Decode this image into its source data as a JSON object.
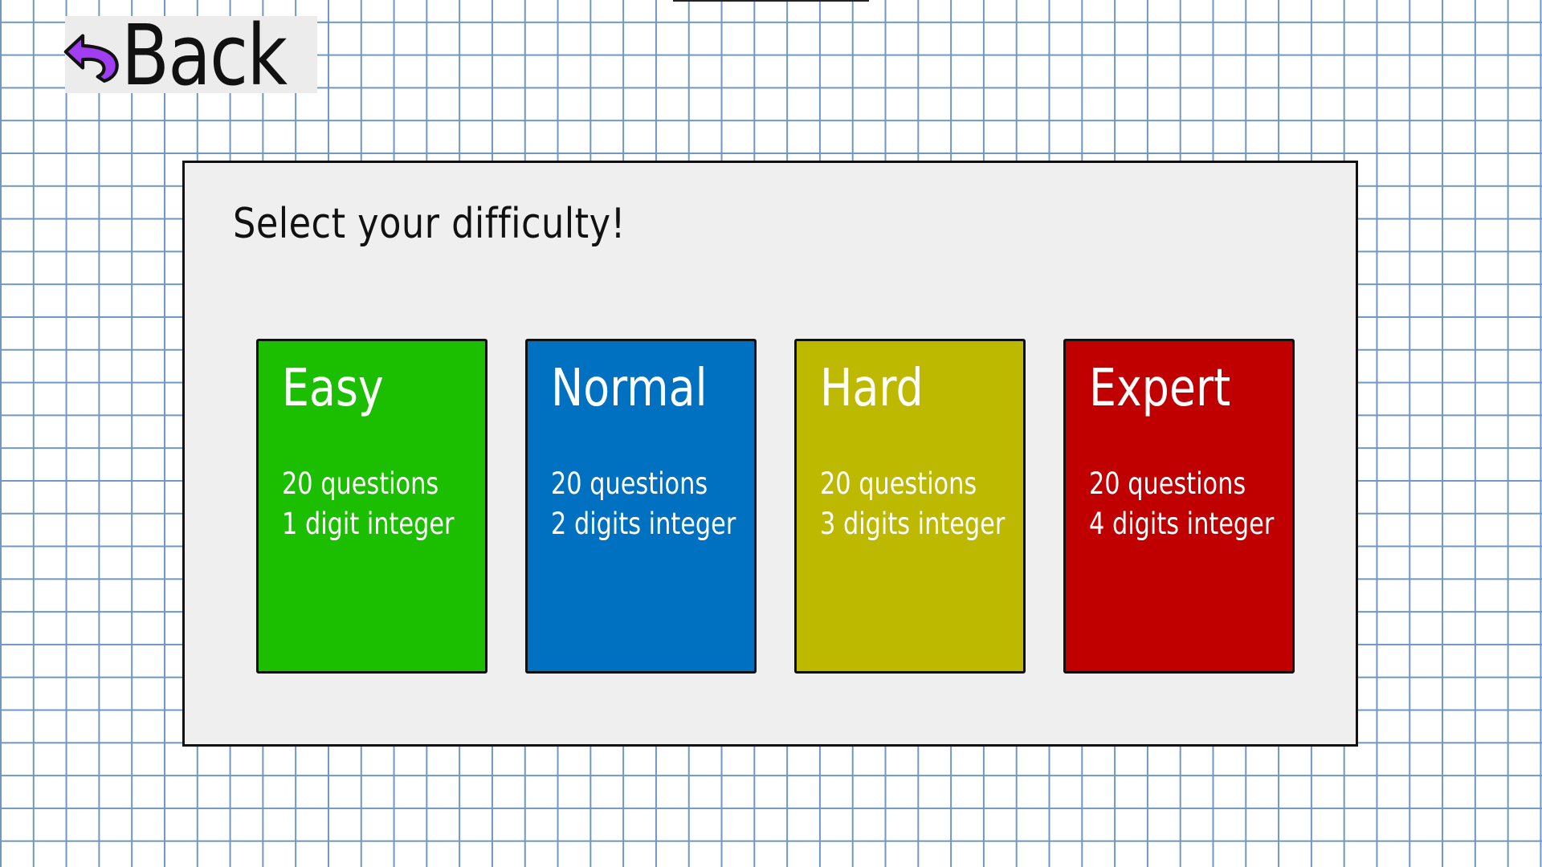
{
  "back": {
    "label": "Back",
    "icon": "curved-back-arrow-icon",
    "icon_color": "#a23ef2"
  },
  "panel": {
    "title": "Select your difficulty!"
  },
  "cards": [
    {
      "title": "Easy",
      "line1": "20 questions",
      "line2": "1 digit integer",
      "color": "#1bbf00"
    },
    {
      "title": "Normal",
      "line1": "20 questions",
      "line2": "2 digits integer",
      "color": "#0070c0"
    },
    {
      "title": "Hard",
      "line1": "20 questions",
      "line2": "3 digits integer",
      "color": "#bcb900"
    },
    {
      "title": "Expert",
      "line1": "20 questions",
      "line2": "4 digits integer",
      "color": "#c00000"
    }
  ],
  "theme": {
    "background": "#ffffff",
    "grid_color": "#6f97c2",
    "panel_background": "#efefef"
  }
}
